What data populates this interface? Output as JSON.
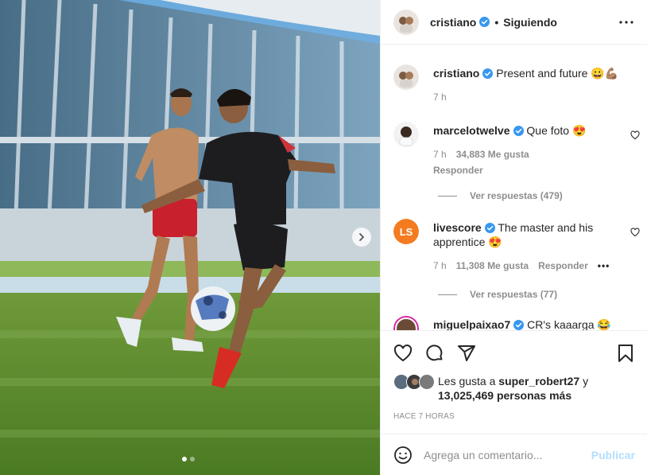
{
  "post": {
    "author": "cristiano",
    "follow_status": "Siguiendo",
    "separator": "•"
  },
  "caption": {
    "username": "cristiano",
    "text": "Present and future 😀💪🏽",
    "time": "7 h"
  },
  "comments": [
    {
      "username": "marcelotwelve",
      "text": "Que foto 😍",
      "time": "7 h",
      "likes": "34,883 Me gusta",
      "reply_label": "Responder",
      "view_replies": "Ver respuestas (479)"
    },
    {
      "username": "livescore",
      "text": "The master and his apprentice 😍",
      "time": "7 h",
      "likes": "11,308 Me gusta",
      "reply_label": "Responder",
      "more_label": "•••",
      "view_replies": "Ver respuestas (77)"
    },
    {
      "username": "miguelpaixao7",
      "text": "CR's kaaarga 😂"
    }
  ],
  "likes_summary": {
    "prefix": "Les gusta a ",
    "user": "super_robert27",
    "conjunction": " y",
    "count": "13,025,469 personas más"
  },
  "timestamp": "HACE 7 HORAS",
  "comment_box": {
    "placeholder": "Agrega un comentario...",
    "publish_label": "Publicar"
  },
  "colors": {
    "verified_blue": "#3897f0",
    "publish_disabled": "#b2dffc",
    "muted_text": "#8e8e8e"
  },
  "icons": [
    "verified-icon",
    "more-options-icon",
    "heart-icon",
    "comment-icon",
    "share-icon",
    "bookmark-icon",
    "emoji-icon",
    "chevron-right-icon"
  ],
  "carousel": {
    "slides": 2,
    "active": 1
  }
}
